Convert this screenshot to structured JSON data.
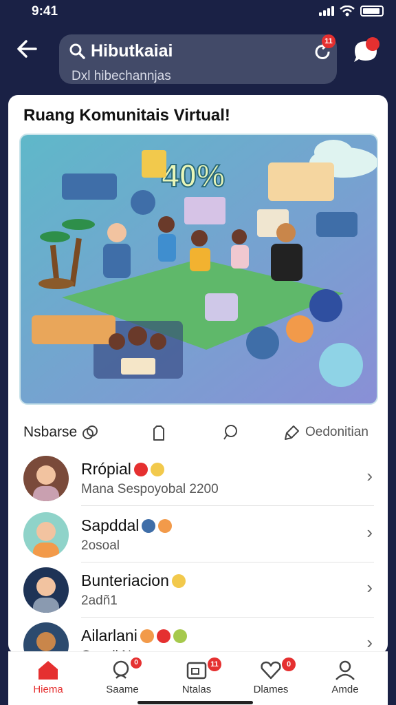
{
  "status": {
    "time": "9:41"
  },
  "header": {
    "back_icon": "arrow-left-icon",
    "search_title": "Hibutkaiai",
    "search_sub": "Dxl hibechannjas",
    "refresh_badge": "11"
  },
  "card": {
    "title": "Ruang Komunitais Virtual!",
    "banner_percent": "40%"
  },
  "tabs": [
    {
      "label": "Nsbarse",
      "icon": "link-icon"
    },
    {
      "label": "",
      "icon": "bookmark-icon"
    },
    {
      "label": "",
      "icon": "chat-bubble-icon"
    },
    {
      "label": "Oedonitian",
      "icon": "pin-icon"
    }
  ],
  "list": [
    {
      "name": "Rrópial",
      "sub": "Mana Sespoyobal 2200",
      "avatar_bg": "#7a4a3a"
    },
    {
      "name": "Sapddal",
      "sub": "2osoal",
      "avatar_bg": "#8fd3c9"
    },
    {
      "name": "Bunteriacion",
      "sub": "2adñ1",
      "avatar_bg": "#1e3356"
    },
    {
      "name": "Ailarlani",
      "sub": "Conall N",
      "avatar_bg": "#2c4a6e"
    }
  ],
  "bottom_nav": [
    {
      "label": "Hiema",
      "icon": "home-icon",
      "badge": ""
    },
    {
      "label": "Saame",
      "icon": "search-icon",
      "badge": "0"
    },
    {
      "label": "Ntalas",
      "icon": "video-icon",
      "badge": "11"
    },
    {
      "label": "Dlames",
      "icon": "heart-icon",
      "badge": "0"
    },
    {
      "label": "Amde",
      "icon": "profile-icon",
      "badge": ""
    }
  ],
  "colors": {
    "accent": "#e53030",
    "header_bg": "#1a2145",
    "search_bg": "#424a68"
  }
}
